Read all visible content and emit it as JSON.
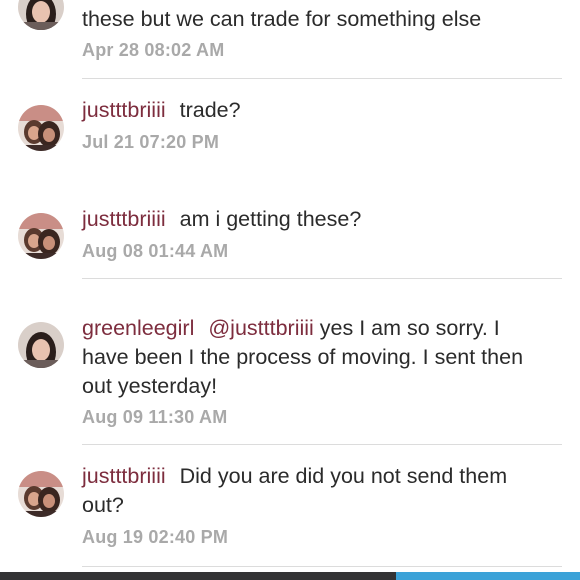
{
  "comments": [
    {
      "user": "",
      "text": "these but we can trade for something else",
      "time": "Apr 28 08:02 AM",
      "avatar": "avatar-greenleegirl"
    },
    {
      "user": "justttbriiii",
      "text": "trade?",
      "time": "Jul 21 07:20 PM",
      "avatar": "avatar-justttbriiii"
    },
    {
      "user": "justttbriiii",
      "text": "am i getting these?",
      "time": "Aug 08 01:44 AM",
      "avatar": "avatar-justttbriiii"
    },
    {
      "user": "greenleegirl",
      "mention": "@justttbriiii",
      "text": "yes I am so sorry. I have been I the process of moving. I sent then out yesterday!",
      "time": "Aug 09 11:30 AM",
      "avatar": "avatar-greenleegirl"
    },
    {
      "user": "justttbriiii",
      "text": "Did you are did you not send them out?",
      "time": "Aug 19 02:40 PM",
      "avatar": "avatar-justttbriiii"
    }
  ],
  "colors": {
    "username": "#7d2d3e",
    "text": "#2b2b2b",
    "timestamp": "#a9a9a9",
    "divider": "#dcdcdc",
    "bottom_bar_dark": "#333335",
    "bottom_bar_accent": "#3ba2d8"
  }
}
